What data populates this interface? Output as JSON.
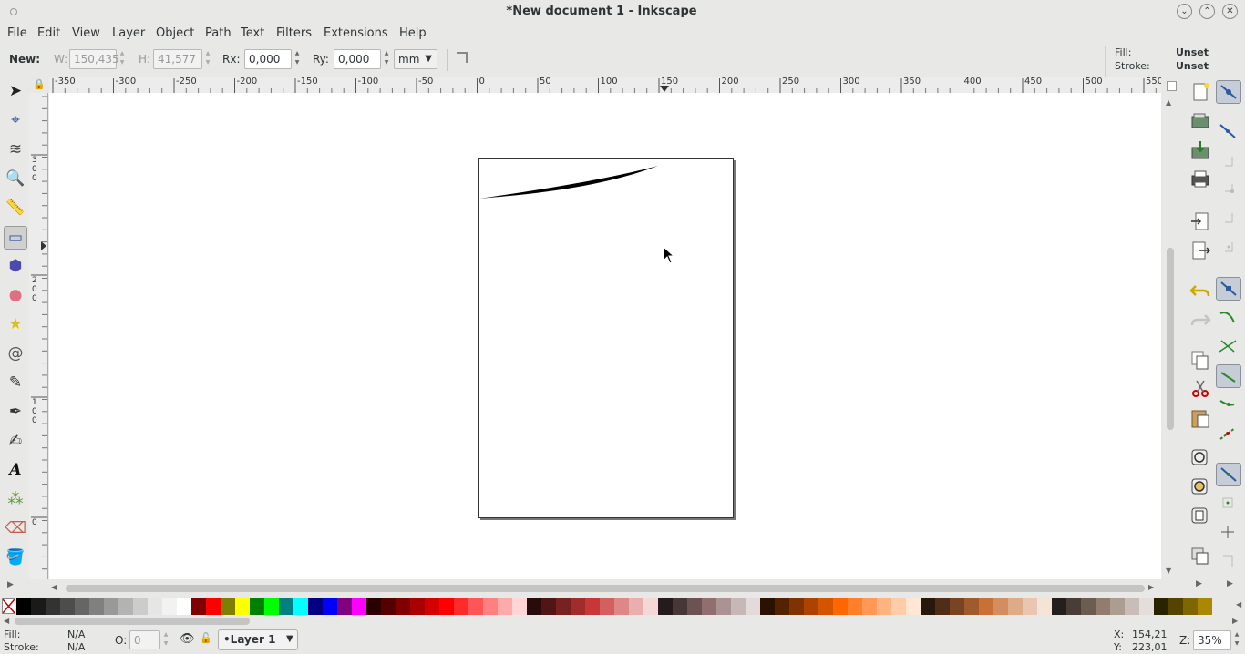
{
  "window": {
    "title": "*New document 1 - Inkscape"
  },
  "menu": [
    "File",
    "Edit",
    "View",
    "Layer",
    "Object",
    "Path",
    "Text",
    "Filters",
    "Extensions",
    "Help"
  ],
  "toolctrl": {
    "new_label": "New:",
    "w_label": "W:",
    "w_value": "150,435",
    "h_label": "H:",
    "h_value": "41,577",
    "rx_label": "Rx:",
    "rx_value": "0,000",
    "ry_label": "Ry:",
    "ry_value": "0,000",
    "unit": "mm",
    "fill_label": "Fill:",
    "fill_value": "Unset",
    "stroke_label": "Stroke:",
    "stroke_value": "Unset"
  },
  "ruler_top_labels": [
    "-350",
    "-300",
    "-250",
    "-200",
    "-150",
    "-100",
    "-50",
    "0",
    "50",
    "100",
    "150",
    "200",
    "250",
    "300",
    "350",
    "400",
    "450",
    "500",
    "550"
  ],
  "ruler_left_labels": [
    [
      "3",
      "0",
      "0"
    ],
    [
      "2",
      "0",
      "0"
    ],
    [
      "1",
      "0",
      "0"
    ],
    [
      "0"
    ]
  ],
  "tools": [
    {
      "name": "selector-tool-icon",
      "glyph": "➤"
    },
    {
      "name": "node-tool-icon",
      "glyph": "⌖"
    },
    {
      "name": "tweak-tool-icon",
      "glyph": "≋"
    },
    {
      "name": "zoom-tool-icon",
      "glyph": "🔍"
    },
    {
      "name": "measure-tool-icon",
      "glyph": "📏"
    },
    {
      "name": "rect-tool-icon",
      "glyph": "▭"
    },
    {
      "name": "3dbox-tool-icon",
      "glyph": "⬢"
    },
    {
      "name": "ellipse-tool-icon",
      "glyph": "●"
    },
    {
      "name": "star-tool-icon",
      "glyph": "★"
    },
    {
      "name": "spiral-tool-icon",
      "glyph": "@"
    },
    {
      "name": "pencil-tool-icon",
      "glyph": "✎"
    },
    {
      "name": "pen-tool-icon",
      "glyph": "✒"
    },
    {
      "name": "calligraphy-tool-icon",
      "glyph": "✍"
    },
    {
      "name": "text-tool-icon",
      "glyph": "A"
    },
    {
      "name": "spray-tool-icon",
      "glyph": "⁂"
    },
    {
      "name": "eraser-tool-icon",
      "glyph": "⌫"
    },
    {
      "name": "paint-bucket-tool-icon",
      "glyph": "🪣"
    }
  ],
  "palette_colors": [
    "#000000",
    "#1a1a1a",
    "#333333",
    "#4d4d4d",
    "#666666",
    "#808080",
    "#999999",
    "#b3b3b3",
    "#cccccc",
    "#e6e6e6",
    "#f2f2f2",
    "#ffffff",
    "#800000",
    "#ff0000",
    "#808000",
    "#ffff00",
    "#008000",
    "#00ff00",
    "#008080",
    "#00ffff",
    "#000080",
    "#0000ff",
    "#800080",
    "#ff00ff",
    "#2b0000",
    "#550000",
    "#800000",
    "#aa0000",
    "#d40000",
    "#ff0000",
    "#ff2a2a",
    "#ff5555",
    "#ff8080",
    "#ffaaaa",
    "#ffd5d5",
    "#280b0b",
    "#501616",
    "#782121",
    "#a02c2c",
    "#c83737",
    "#d35f5f",
    "#de8787",
    "#e9afaf",
    "#f4d7d7",
    "#241c1c",
    "#483737",
    "#6c5353",
    "#916f6f",
    "#ac9393",
    "#c8b7b7",
    "#e3dbdb",
    "#2b1100",
    "#552200",
    "#803300",
    "#aa4400",
    "#d45500",
    "#ff6600",
    "#ff7f2a",
    "#ff9955",
    "#ffb380",
    "#ffccaa",
    "#ffe6d5",
    "#28170b",
    "#502d16",
    "#784421",
    "#a05a2c",
    "#c87137",
    "#d38d5f",
    "#deaa87",
    "#e9c6af",
    "#f4e3d7",
    "#241f1c",
    "#483e37",
    "#6c5d53",
    "#917c6f",
    "#ac9d93",
    "#c8beb7",
    "#e3dedb",
    "#2b2200",
    "#554400",
    "#806600",
    "#aa8800"
  ],
  "status": {
    "fill_label": "Fill:",
    "fill_value": "N/A",
    "stroke_label": "Stroke:",
    "stroke_value": "N/A",
    "opacity_label": "O:",
    "opacity_value": "0",
    "layer": "•Layer 1",
    "x_label": "X:",
    "x_value": "154,21",
    "y_label": "Y:",
    "y_value": "223,01",
    "zoom_label": "Z:",
    "zoom_value": "35%"
  }
}
